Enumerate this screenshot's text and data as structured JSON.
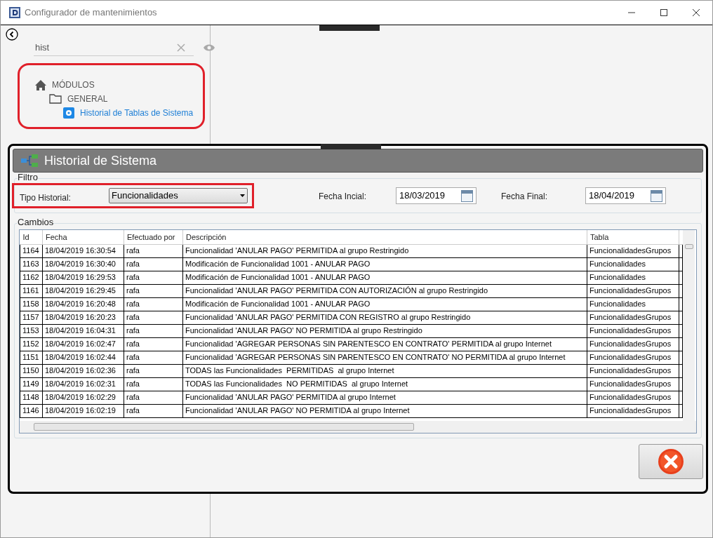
{
  "window": {
    "title": "Configurador de mantenimientos"
  },
  "search": {
    "value": "hist"
  },
  "tree": [
    {
      "label": "MÓDULOS",
      "kind": "home",
      "children": [
        {
          "label": "GENERAL",
          "kind": "folder",
          "children": [
            {
              "label": "Historial de Tablas de Sistema",
              "kind": "setting",
              "selected": true
            }
          ]
        }
      ]
    }
  ],
  "panel": {
    "title": "Historial de Sistema"
  },
  "filter": {
    "title": "Filtro",
    "type_label": "Tipo Historial:",
    "type_value": "Funcionalidades",
    "start_label": "Fecha Incial:",
    "start_value": "18/03/2019",
    "end_label": "Fecha Final:",
    "end_value": "18/04/2019"
  },
  "changes": {
    "title": "Cambios",
    "columns": [
      "Id",
      "Fecha",
      "Efectuado por",
      "Descripción",
      "Tabla"
    ],
    "rows": [
      [
        "1164",
        "18/04/2019 16:30:54",
        "rafa",
        "Funcionalidad 'ANULAR PAGO' PERMITIDA al grupo Restringido",
        "FuncionalidadesGrupos"
      ],
      [
        "1163",
        "18/04/2019 16:30:40",
        "rafa",
        "Modificación de Funcionalidad 1001 - ANULAR PAGO",
        "Funcionalidades"
      ],
      [
        "1162",
        "18/04/2019 16:29:53",
        "rafa",
        "Modificación de Funcionalidad 1001 - ANULAR PAGO",
        "Funcionalidades"
      ],
      [
        "1161",
        "18/04/2019 16:29:45",
        "rafa",
        "Funcionalidad 'ANULAR PAGO' PERMITIDA CON AUTORIZACIÓN al grupo Restringido",
        "FuncionalidadesGrupos"
      ],
      [
        "1158",
        "18/04/2019 16:20:48",
        "rafa",
        "Modificación de Funcionalidad 1001 - ANULAR PAGO",
        "Funcionalidades"
      ],
      [
        "1157",
        "18/04/2019 16:20:23",
        "rafa",
        "Funcionalidad 'ANULAR PAGO' PERMITIDA CON REGISTRO al grupo Restringido",
        "FuncionalidadesGrupos"
      ],
      [
        "1153",
        "18/04/2019 16:04:31",
        "rafa",
        "Funcionalidad 'ANULAR PAGO' NO PERMITIDA al grupo Restringido",
        "FuncionalidadesGrupos"
      ],
      [
        "1152",
        "18/04/2019 16:02:47",
        "rafa",
        "Funcionalidad 'AGREGAR PERSONAS SIN PARENTESCO EN CONTRATO' PERMITIDA al grupo Internet",
        "FuncionalidadesGrupos"
      ],
      [
        "1151",
        "18/04/2019 16:02:44",
        "rafa",
        "Funcionalidad 'AGREGAR PERSONAS SIN PARENTESCO EN CONTRATO' NO PERMITIDA al grupo Internet",
        "FuncionalidadesGrupos"
      ],
      [
        "1150",
        "18/04/2019 16:02:36",
        "rafa",
        "TODAS las Funcionalidades  PERMITIDAS  al grupo Internet",
        "FuncionalidadesGrupos"
      ],
      [
        "1149",
        "18/04/2019 16:02:31",
        "rafa",
        "TODAS las Funcionalidades  NO PERMITIDAS  al grupo Internet",
        "FuncionalidadesGrupos"
      ],
      [
        "1148",
        "18/04/2019 16:02:29",
        "rafa",
        "Funcionalidad 'ANULAR PAGO' PERMITIDA al grupo Internet",
        "FuncionalidadesGrupos"
      ],
      [
        "1146",
        "18/04/2019 16:02:19",
        "rafa",
        "Funcionalidad 'ANULAR PAGO' NO PERMITIDA al grupo Internet",
        "FuncionalidadesGrupos"
      ]
    ]
  }
}
